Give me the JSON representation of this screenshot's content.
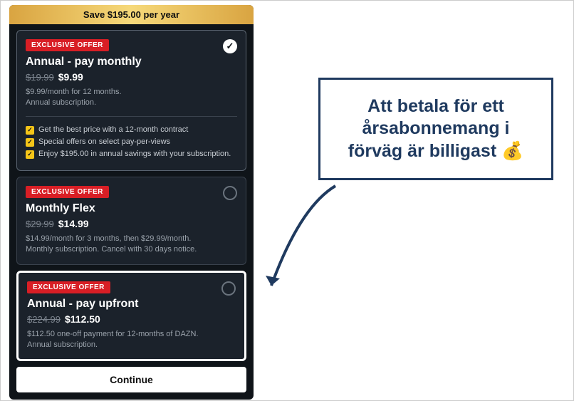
{
  "banner": {
    "text": "Save $195.00 per year"
  },
  "plans": [
    {
      "badge": "EXCLUSIVE OFFER",
      "title": "Annual - pay monthly",
      "old_price": "$19.99",
      "new_price": "$9.99",
      "desc_line1": "$9.99/month for 12 months.",
      "desc_line2": "Annual subscription.",
      "selected": true,
      "benefits": [
        "Get the best price with a 12-month contract",
        "Special offers on select pay-per-views",
        "Enjoy $195.00 in annual savings with your subscription."
      ]
    },
    {
      "badge": "EXCLUSIVE OFFER",
      "title": "Monthly Flex",
      "old_price": "$29.99",
      "new_price": "$14.99",
      "desc_line1": "$14.99/month for 3 months, then $29.99/month.",
      "desc_line2": "Monthly subscription. Cancel with 30 days notice.",
      "selected": false
    },
    {
      "badge": "EXCLUSIVE OFFER",
      "title": "Annual - pay upfront",
      "old_price": "$224.99",
      "new_price": "$112.50",
      "desc_line1": "$112.50 one-off payment for 12-months of DAZN.",
      "desc_line2": "Annual subscription.",
      "selected": false,
      "highlighted": true
    }
  ],
  "continue_label": "Continue",
  "callout_text": "Att betala för ett årsabonnemang i förväg är billigast 💰"
}
